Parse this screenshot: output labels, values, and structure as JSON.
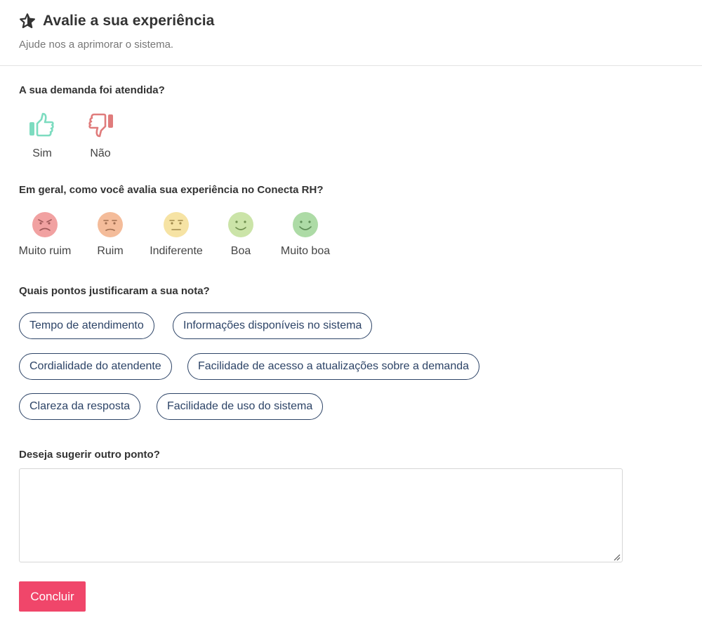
{
  "header": {
    "title": "Avalie a sua experiência",
    "subtitle": "Ajude nos a aprimorar o sistema.",
    "icon": "star-outline-icon"
  },
  "q1": {
    "question": "A sua demanda foi atendida?",
    "options": [
      {
        "label": "Sim",
        "icon": "thumbs-up-icon",
        "color": "#7ddcc0"
      },
      {
        "label": "Não",
        "icon": "thumbs-down-icon",
        "color": "#e07c7c"
      }
    ]
  },
  "q2": {
    "question": "Em geral, como você avalia sua experiência no Conecta RH?",
    "options": [
      {
        "label": "Muito ruim",
        "icon": "angry-face-icon",
        "color": "#f1a1a1"
      },
      {
        "label": "Ruim",
        "icon": "frowning-face-icon",
        "color": "#f4bc9a"
      },
      {
        "label": "Indiferente",
        "icon": "neutral-face-icon",
        "color": "#f6e3a4"
      },
      {
        "label": "Boa",
        "icon": "smiling-face-icon",
        "color": "#cbe4a8"
      },
      {
        "label": "Muito boa",
        "icon": "happy-face-icon",
        "color": "#addba6"
      }
    ]
  },
  "q3": {
    "question": "Quais pontos justificaram a sua nota?",
    "chips": [
      "Tempo de atendimento",
      "Informações disponíveis no sistema",
      "Cordialidade do atendente",
      "Facilidade de acesso a atualizações sobre a demanda",
      "Clareza da resposta",
      "Facilidade de uso do sistema"
    ]
  },
  "q4": {
    "question": "Deseja sugerir outro ponto?",
    "value": "",
    "placeholder": ""
  },
  "submit_label": "Concluir",
  "colors": {
    "accent": "#f0466a",
    "chip_border": "#2d4467"
  }
}
